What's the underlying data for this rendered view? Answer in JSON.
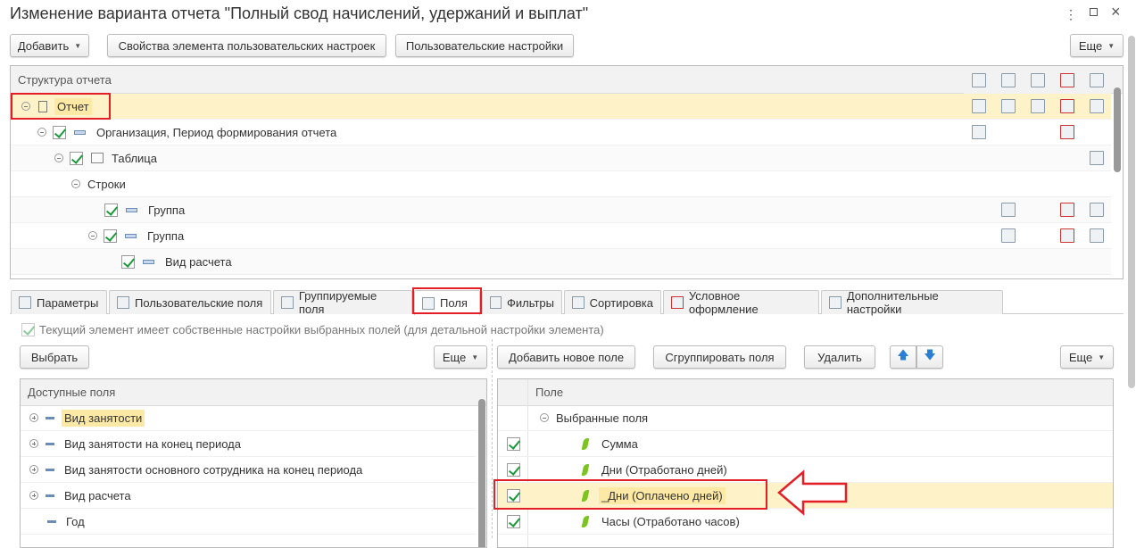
{
  "window": {
    "title": "Изменение варианта отчета \"Полный свод начислений, удержаний и выплат\""
  },
  "toolbar": {
    "add": "Добавить",
    "props": "Свойства элемента пользовательских настроек",
    "user_settings": "Пользовательские настройки",
    "more": "Еще"
  },
  "structure": {
    "header": "Структура отчета",
    "rows": [
      {
        "label": "Отчет",
        "level": 0
      },
      {
        "label": "Организация, Период формирования отчета",
        "level": 1
      },
      {
        "label": "Таблица",
        "level": 2
      },
      {
        "label": "Строки",
        "level": 3
      },
      {
        "label": "Группа",
        "level": 4
      },
      {
        "label": "Группа",
        "level": 4
      },
      {
        "label": "Вид расчета",
        "level": 5
      }
    ]
  },
  "tabs": [
    "Параметры",
    "Пользовательские поля",
    "Группируемые поля",
    "Поля",
    "Фильтры",
    "Сортировка",
    "Условное оформление",
    "Дополнительные настройки"
  ],
  "active_tab": "Поля",
  "own_settings_label": "Текущий элемент имеет собственные настройки выбранных полей (для детальной настройки элемента)",
  "left": {
    "select": "Выбрать",
    "more": "Еще",
    "header": "Доступные поля",
    "rows": [
      "Вид занятости",
      "Вид занятости на конец периода",
      "Вид занятости основного сотрудника на конец периода",
      "Вид расчета",
      "Год"
    ]
  },
  "right": {
    "add_field": "Добавить новое поле",
    "group_fields": "Сгруппировать поля",
    "delete": "Удалить",
    "more": "Еще",
    "header": "Поле",
    "group": "Выбранные поля",
    "rows": [
      "Сумма",
      "Дни (Отработано дней)",
      "_Дни (Оплачено дней)",
      "Часы (Отработано часов)"
    ]
  },
  "colors": {
    "highlight": "#fdf2c8",
    "selected": "#fde9a6",
    "annotation": "#e41e26",
    "check": "#1a9a3a"
  }
}
